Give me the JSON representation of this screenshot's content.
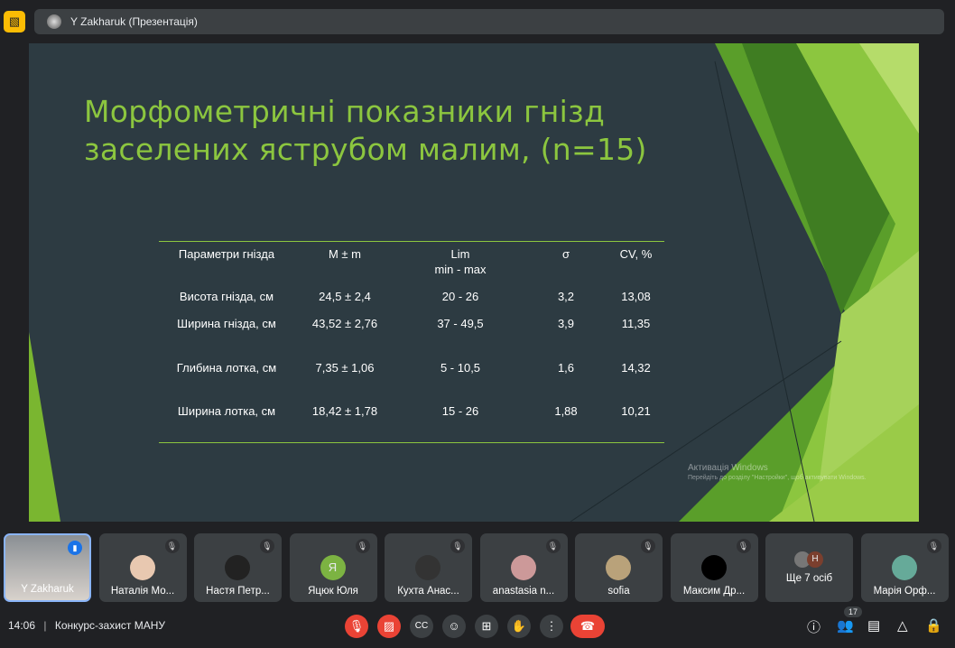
{
  "topbar": {
    "title": "Y Zakharuk (Презентація)",
    "icon": "presentation-off-icon"
  },
  "slide": {
    "title_line1": "Морфометричні показники гнізд",
    "title_line2": "заселених яструбом малим, (n=15)",
    "table": {
      "headers": [
        "Параметри гнізда",
        "M ± m",
        "Lim\nmin - max",
        "σ",
        "CV, %"
      ],
      "header_lim_line1": "Lim",
      "header_lim_line2": "min - max",
      "rows": [
        [
          "Висота гнізда, см",
          "24,5 ± 2,4",
          "20 - 26",
          "3,2",
          "13,08"
        ],
        [
          "Ширина гнізда, см",
          "43,52 ± 2,76",
          "37 - 49,5",
          "3,9",
          "11,35"
        ],
        [
          "Глибина лотка, см",
          "7,35 ± 1,06",
          "5 - 10,5",
          "1,6",
          "14,32"
        ],
        [
          "Ширина лотка, см",
          "18,42 ± 1,78",
          "15 - 26",
          "1,88",
          "10,21"
        ]
      ]
    },
    "watermark_line1": "Активація Windows",
    "watermark_line2": "Перейдіть до розділу \"Настройки\", щоб активувати Windows.",
    "accent": "#8cc63f"
  },
  "participants": [
    {
      "name": "Y Zakharuk",
      "speaking": true
    },
    {
      "name": "Наталія Мо..."
    },
    {
      "name": "Настя Петр..."
    },
    {
      "name": "Яцюк Юля",
      "initial": "Я"
    },
    {
      "name": "Кухта Анас..."
    },
    {
      "name": "anastasia n..."
    },
    {
      "name": "sofia"
    },
    {
      "name": "Максим Др..."
    },
    {
      "name": "Ще 7 осіб",
      "initial": "Н"
    },
    {
      "name": "Марія Орф..."
    }
  ],
  "bottombar": {
    "time": "14:06",
    "separator": "|",
    "meeting": "Конкурс-захист МАНУ",
    "people_count": "17"
  }
}
